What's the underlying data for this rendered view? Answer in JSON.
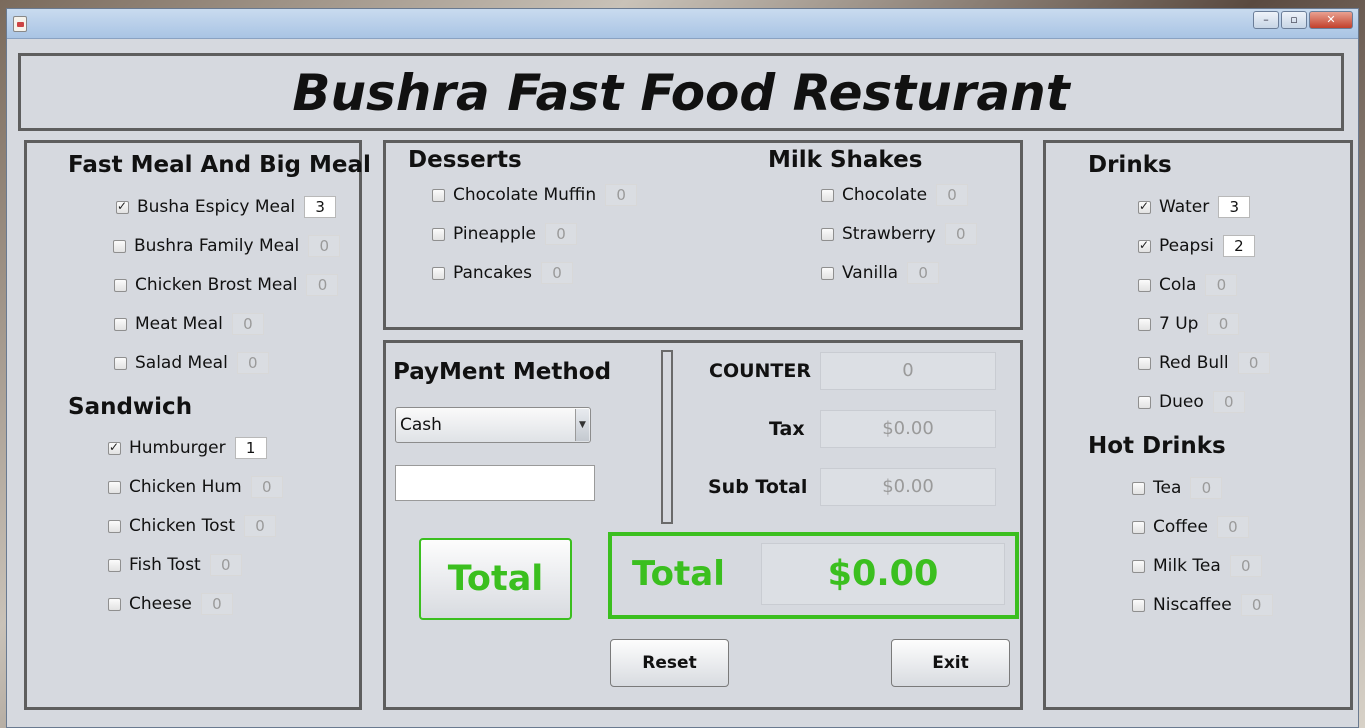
{
  "app": {
    "title": "Bushra Fast Food Resturant"
  },
  "window_controls": {
    "minimize": "–",
    "maximize": "▫",
    "close": "✕"
  },
  "fast_meal": {
    "heading": "Fast Meal And Big Meal",
    "items": [
      {
        "label": "Busha Espicy Meal",
        "qty": "3",
        "checked": true
      },
      {
        "label": "Bushra Family Meal",
        "qty": "0",
        "checked": false
      },
      {
        "label": "Chicken Brost Meal",
        "qty": "0",
        "checked": false
      },
      {
        "label": "Meat Meal",
        "qty": "0",
        "checked": false
      },
      {
        "label": "Salad Meal",
        "qty": "0",
        "checked": false
      }
    ]
  },
  "sandwich": {
    "heading": "Sandwich",
    "items": [
      {
        "label": "Humburger",
        "qty": "1",
        "checked": true
      },
      {
        "label": "Chicken Hum",
        "qty": "0",
        "checked": false
      },
      {
        "label": "Chicken Tost",
        "qty": "0",
        "checked": false
      },
      {
        "label": "Fish Tost",
        "qty": "0",
        "checked": false
      },
      {
        "label": "Cheese",
        "qty": "0",
        "checked": false
      }
    ]
  },
  "desserts": {
    "heading": "Desserts",
    "items": [
      {
        "label": "Chocolate Muffin",
        "qty": "0",
        "checked": false
      },
      {
        "label": "Pineapple",
        "qty": "0",
        "checked": false
      },
      {
        "label": "Pancakes",
        "qty": "0",
        "checked": false
      }
    ]
  },
  "milk_shakes": {
    "heading": "Milk Shakes",
    "items": [
      {
        "label": "Chocolate",
        "qty": "0",
        "checked": false
      },
      {
        "label": "Strawberry",
        "qty": "0",
        "checked": false
      },
      {
        "label": "Vanilla",
        "qty": "0",
        "checked": false
      }
    ]
  },
  "drinks": {
    "heading": "Drinks",
    "items": [
      {
        "label": "Water",
        "qty": "3",
        "checked": true
      },
      {
        "label": "Peapsi",
        "qty": "2",
        "checked": true
      },
      {
        "label": "Cola",
        "qty": "0",
        "checked": false
      },
      {
        "label": "7 Up",
        "qty": "0",
        "checked": false
      },
      {
        "label": "Red Bull",
        "qty": "0",
        "checked": false
      },
      {
        "label": "Dueo",
        "qty": "0",
        "checked": false
      }
    ]
  },
  "hot_drinks": {
    "heading": "Hot Drinks",
    "items": [
      {
        "label": "Tea",
        "qty": "0",
        "checked": false
      },
      {
        "label": "Coffee",
        "qty": "0",
        "checked": false
      },
      {
        "label": "Milk Tea",
        "qty": "0",
        "checked": false
      },
      {
        "label": "Niscaffee",
        "qty": "0",
        "checked": false
      }
    ]
  },
  "payment": {
    "heading": "PayMent Method",
    "method": "Cash",
    "amount": ""
  },
  "summary": {
    "counter_label": "COUNTER",
    "counter_value": "0",
    "tax_label": "Tax",
    "tax_value": "$0.00",
    "subtotal_label": "Sub Total",
    "subtotal_value": "$0.00",
    "total_label": "Total",
    "total_value": "$0.00"
  },
  "buttons": {
    "total": "Total",
    "reset": "Reset",
    "exit": "Exit"
  },
  "colors": {
    "accent_green": "#3bbf1f",
    "panel_border": "#5e5e5e",
    "window_bg": "#d6d9df"
  }
}
